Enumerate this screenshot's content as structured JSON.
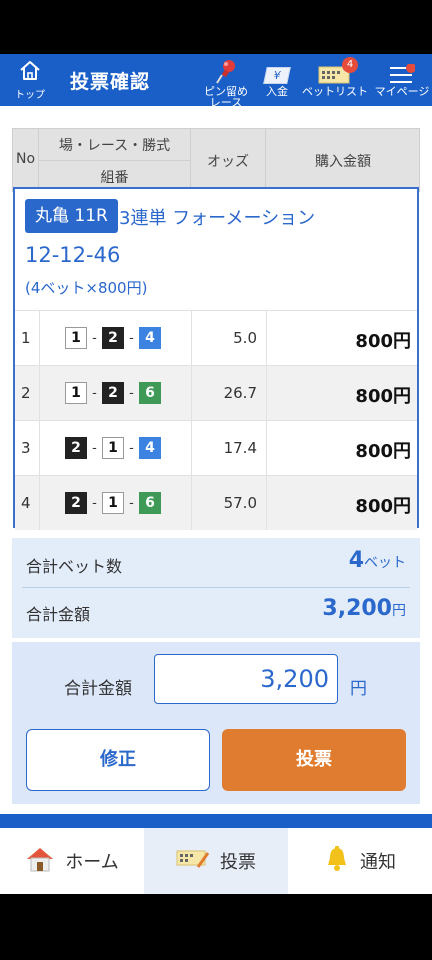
{
  "header": {
    "top_label": "トップ",
    "title": "投票確認",
    "pin_label_line1": "ピン留め",
    "pin_label_line2": "レース",
    "deposit_label": "入金",
    "betlist_label": "ベットリスト",
    "betlist_badge": "4",
    "mypage_label": "マイページ",
    "deposit_icon_char": "¥"
  },
  "table_header": {
    "no": "No",
    "race_top": "場・レース・勝式",
    "race_bottom": "組番",
    "odds": "オッズ",
    "amount": "購入金額"
  },
  "race": {
    "badge": "丸亀 11R",
    "bet_type": "3連単 フォーメーション",
    "combination": "12-12-46",
    "bet_summary": "(4ベット×800円)"
  },
  "rows": [
    {
      "no": "1",
      "b1": "1",
      "b2": "2",
      "b3": "4",
      "odds": "5.0",
      "amount": "800円"
    },
    {
      "no": "2",
      "b1": "1",
      "b2": "2",
      "b3": "6",
      "odds": "26.7",
      "amount": "800円"
    },
    {
      "no": "3",
      "b1": "2",
      "b2": "1",
      "b3": "4",
      "odds": "17.4",
      "amount": "800円"
    },
    {
      "no": "4",
      "b1": "2",
      "b2": "1",
      "b3": "6",
      "odds": "57.0",
      "amount": "800円"
    }
  ],
  "dash": "-",
  "summary": {
    "bet_count_label": "合計ベット数",
    "bet_count_value": "4",
    "bet_count_unit": "ベット",
    "total_label": "合計金額",
    "total_value": "3,200",
    "total_unit": "円"
  },
  "total_input": {
    "label": "合計金額",
    "value": "3,200",
    "unit": "円"
  },
  "buttons": {
    "fix": "修正",
    "vote": "投票"
  },
  "tabs": {
    "home": "ホーム",
    "vote": "投票",
    "notify": "通知"
  },
  "colors": {
    "brand_blue": "#1a5fc8",
    "accent_orange": "#e07c30",
    "boat1": "#ffffff",
    "boat2": "#222222",
    "boat4": "#3c82e0",
    "boat6": "#3f9a57"
  }
}
